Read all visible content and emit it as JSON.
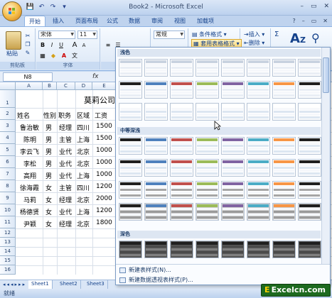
{
  "window": {
    "title": "Book2 - Microsoft Excel",
    "controls": [
      "–",
      "▭",
      "✕"
    ]
  },
  "quick_access": [
    "💾",
    "↶",
    "↷",
    "▾"
  ],
  "tabs": [
    "开始",
    "插入",
    "页面布局",
    "公式",
    "数据",
    "审阅",
    "视图",
    "加载项"
  ],
  "tabs_right": [
    "?",
    "–",
    "▭",
    "✕"
  ],
  "ribbon": {
    "clipboard": {
      "paste": "粘贴",
      "label": "剪贴板"
    },
    "font": {
      "name": "宋体",
      "size": "11",
      "label": "字体",
      "bold": "B",
      "italic": "I",
      "underline": "U",
      "grow": "A",
      "shrink": "A"
    },
    "alignment": {
      "wrap": "≡"
    },
    "number": {
      "format": "常规"
    },
    "styles": {
      "conditional": "条件格式",
      "table_format": "套用表格格式"
    },
    "cells": {
      "insert": "插入",
      "delete": "删除"
    },
    "editing": {
      "sum": "Σ",
      "sort": "A",
      "find": "Z"
    }
  },
  "formula_bar": {
    "name_box": "N8",
    "fx": "fx"
  },
  "columns": [
    "A",
    "B",
    "C",
    "D",
    "E"
  ],
  "rows": [
    "1",
    "2",
    "3",
    "4",
    "5",
    "6",
    "7",
    "8",
    "9",
    "10",
    "11",
    "12",
    "13",
    "14",
    "15",
    "16"
  ],
  "sheet_title": "莫莉公司",
  "table": {
    "headers": [
      "姓名",
      "性别",
      "职务",
      "区域",
      "工资"
    ],
    "rows": [
      [
        "鲁治敏",
        "男",
        "经理",
        "四川",
        "1500"
      ],
      [
        "陈明",
        "男",
        "主管",
        "上海",
        "1500"
      ],
      [
        "李云飞",
        "男",
        "业代",
        "北京",
        "1000"
      ],
      [
        "李松",
        "男",
        "业代",
        "北京",
        "1000"
      ],
      [
        "高翔",
        "男",
        "业代",
        "上海",
        "1000"
      ],
      [
        "徐海霞",
        "女",
        "主管",
        "四川",
        "1200"
      ],
      [
        "马莉",
        "女",
        "经理",
        "北京",
        "2000"
      ],
      [
        "杨德贤",
        "女",
        "业代",
        "上海",
        "1200"
      ],
      [
        "尹颖",
        "女",
        "经理",
        "北京",
        "1800"
      ]
    ]
  },
  "sheet_tabs": [
    "Sheet1",
    "Sheet2",
    "Sheet3"
  ],
  "status": "就绪",
  "gallery": {
    "sections": [
      "浅色",
      "中等深浅",
      "深色"
    ],
    "footer": [
      "新建表样式(N)...",
      "新建数据透视表样式(P)..."
    ]
  },
  "colors": {
    "accent": "#4f81bd",
    "light_rows": "#dce6f1",
    "medium_rows": "#95b3d7",
    "dark_head": "#1f3864"
  },
  "watermark": {
    "prefix": "E",
    "text": "Excelcn.com"
  }
}
